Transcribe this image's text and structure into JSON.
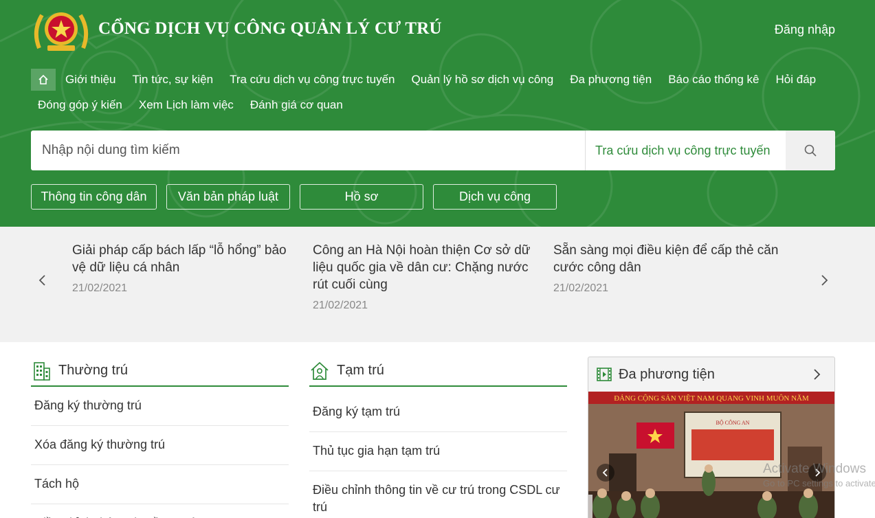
{
  "header": {
    "site_title": "CỔNG DỊCH VỤ CÔNG QUẢN LÝ CƯ TRÚ",
    "login_label": "Đăng nhập",
    "colors": {
      "primary_green": "#2e8b3a",
      "gold": "#e8b92a",
      "red": "#c8102e"
    }
  },
  "nav": {
    "home_icon": "home-icon",
    "row1": [
      "Giới thiệu",
      "Tin tức, sự kiện",
      "Tra cứu dịch vụ công trực tuyến",
      "Quản lý hồ sơ dịch vụ công",
      "Đa phương tiện",
      "Báo cáo thống kê",
      "Hỏi đáp"
    ],
    "row2": [
      "Đóng góp ý kiến",
      "Xem Lịch làm việc",
      "Đánh giá cơ quan"
    ]
  },
  "search": {
    "placeholder": "Nhập nội dung tìm kiếm",
    "scope_label": "Tra cứu dịch vụ công trực tuyến",
    "button_icon": "search-icon"
  },
  "quick_links": [
    "Thông tin công dân",
    "Văn bản pháp luật",
    "Hồ sơ",
    "Dịch vụ công"
  ],
  "news": {
    "items": [
      {
        "title": "Giải pháp cấp bách lấp “lỗ hổng” bảo vệ dữ liệu cá nhân",
        "date": "21/02/2021"
      },
      {
        "title": "Công an Hà Nội hoàn thiện Cơ sở dữ liệu quốc gia về dân cư: Chặng nước rút cuối cùng",
        "date": "21/02/2021"
      },
      {
        "title": "Sẵn sàng mọi điều kiện để cấp thẻ căn cước công dân",
        "date": "21/02/2021"
      }
    ]
  },
  "thuong_tru": {
    "title": "Thường trú",
    "icon": "building-icon",
    "items": [
      "Đăng ký thường trú",
      "Xóa đăng ký thường trú",
      "Tách hộ",
      "Điều chỉnh thông tin về cư trú trong CSDL"
    ]
  },
  "tam_tru": {
    "title": "Tạm trú",
    "icon": "house-person-icon",
    "items": [
      "Đăng ký tạm trú",
      "Thủ tục gia hạn tạm trú",
      "Điều chỉnh thông tin về cư trú trong CSDL cư trú"
    ]
  },
  "media": {
    "title": "Đa phương tiện",
    "icon": "film-icon",
    "banner_text": "ĐẢNG CỘNG SẢN VIỆT NAM QUANG VINH MUÔN NĂM",
    "slide_title": "BỘ CÔNG AN"
  },
  "watermark": {
    "line1": "Activate Windows",
    "line2": "Go to PC settings to activate"
  }
}
